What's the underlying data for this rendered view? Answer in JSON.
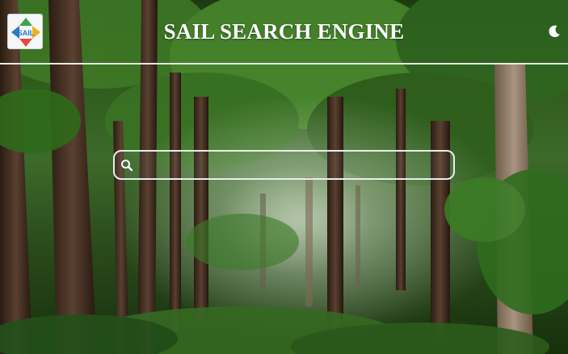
{
  "header": {
    "logo_text": "SAIL",
    "title": "SAIL SEARCH ENGINE",
    "theme_toggle_icon": "moon-icon"
  },
  "search": {
    "icon": "search-icon",
    "placeholder": "",
    "value": ""
  },
  "colors": {
    "title": "#ffffff",
    "divider": "#e6ece4",
    "search_border": "#e8efe8",
    "logo_bg": "#f4f6f8",
    "logo_text": "#2a7bbf"
  }
}
